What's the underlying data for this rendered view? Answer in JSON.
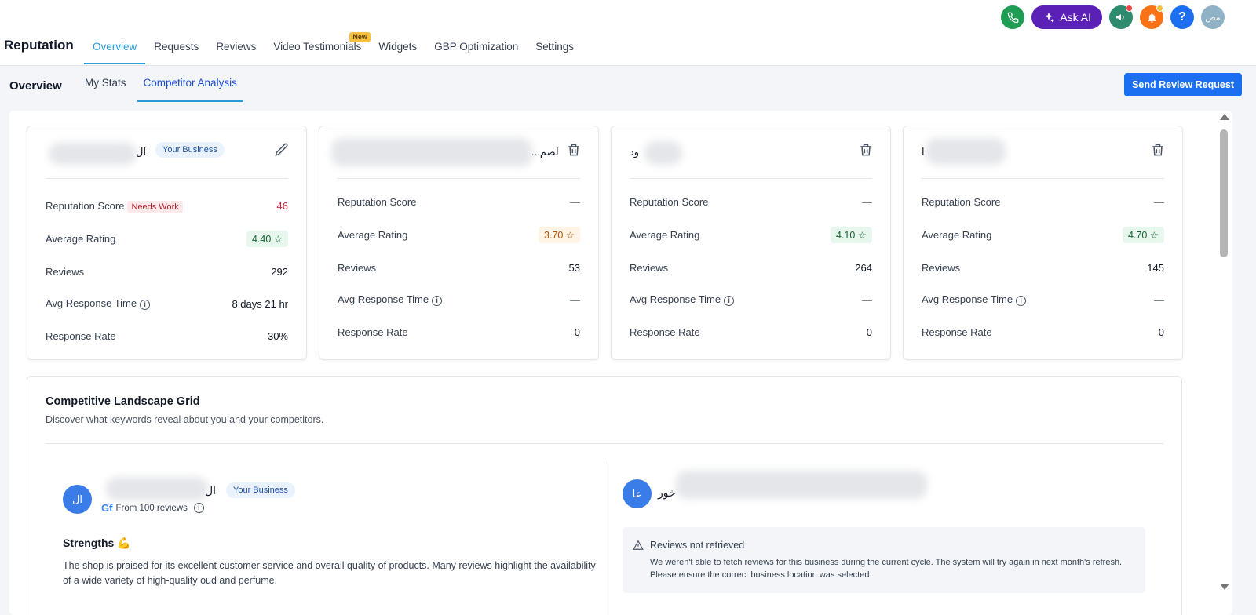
{
  "header": {
    "app_title": "Reputation",
    "nav": [
      {
        "label": "Overview",
        "active": true
      },
      {
        "label": "Requests"
      },
      {
        "label": "Reviews"
      },
      {
        "label": "Video Testimonials",
        "badge": "New"
      },
      {
        "label": "Widgets"
      },
      {
        "label": "GBP Optimization"
      },
      {
        "label": "Settings"
      }
    ],
    "ask_ai_label": "Ask AI",
    "help_label": "?",
    "user_initials": "مص",
    "colors": {
      "phone": "#1f9d55",
      "ask_ai": "#5b21b6",
      "megaphone": "#2e8b6e",
      "bell": "#f97316",
      "help": "#1d6ff2",
      "avatar": "#8fb2c6"
    }
  },
  "subheader": {
    "title": "Overview",
    "tabs": [
      {
        "label": "My Stats"
      },
      {
        "label": "Competitor Analysis",
        "active": true
      }
    ],
    "send_request_label": "Send Review Request"
  },
  "cards": [
    {
      "name": "ال",
      "badge": "Your Business",
      "action_icon": "pencil-icon",
      "metrics": {
        "reputation_label": "Reputation Score",
        "reputation_tag": "Needs Work",
        "reputation_value": "46",
        "rating_label": "Average Rating",
        "rating_value": "4.40 ☆",
        "reviews_label": "Reviews",
        "reviews_value": "292",
        "response_time_label": "Avg Response Time",
        "response_time_value": "8 days 21 hr",
        "response_rate_label": "Response Rate",
        "response_rate_value": "30%"
      }
    },
    {
      "name": "...لصم",
      "action_icon": "trash-icon",
      "metrics": {
        "reputation_label": "Reputation Score",
        "reputation_value": "—",
        "rating_label": "Average Rating",
        "rating_value": "3.70 ☆",
        "reviews_label": "Reviews",
        "reviews_value": "53",
        "response_time_label": "Avg Response Time",
        "response_time_value": "—",
        "response_rate_label": "Response Rate",
        "response_rate_value": "0"
      }
    },
    {
      "name": "ود",
      "action_icon": "trash-icon",
      "metrics": {
        "reputation_label": "Reputation Score",
        "reputation_value": "—",
        "rating_label": "Average Rating",
        "rating_value": "4.10 ☆",
        "reviews_label": "Reviews",
        "reviews_value": "264",
        "response_time_label": "Avg Response Time",
        "response_time_value": "—",
        "response_rate_label": "Response Rate",
        "response_rate_value": "0"
      }
    },
    {
      "name": "ا",
      "action_icon": "trash-icon",
      "metrics": {
        "reputation_label": "Reputation Score",
        "reputation_value": "—",
        "rating_label": "Average Rating",
        "rating_value": "4.70 ☆",
        "reviews_label": "Reviews",
        "reviews_value": "145",
        "response_time_label": "Avg Response Time",
        "response_time_value": "—",
        "response_rate_label": "Response Rate",
        "response_rate_value": "0"
      }
    }
  ],
  "landscape": {
    "title": "Competitive Landscape Grid",
    "subtitle": "Discover what keywords reveal about you and your competitors.",
    "own": {
      "avatar": "ال",
      "name": "ال",
      "badge": "Your Business",
      "from_reviews": "From 100 reviews",
      "strengths_title": "Strengths 💪",
      "strengths_text": "The shop is praised for its excellent customer service and overall quality of products. Many reviews highlight the availability of a wide variety of high-quality oud and perfume."
    },
    "competitor": {
      "avatar": "عا",
      "name": "خور",
      "warning_title": "Reviews not retrieved",
      "warning_text": "We weren't able to fetch reviews for this business during the current cycle. The system will try again in next month's refresh. Please ensure the correct business location was selected."
    }
  }
}
